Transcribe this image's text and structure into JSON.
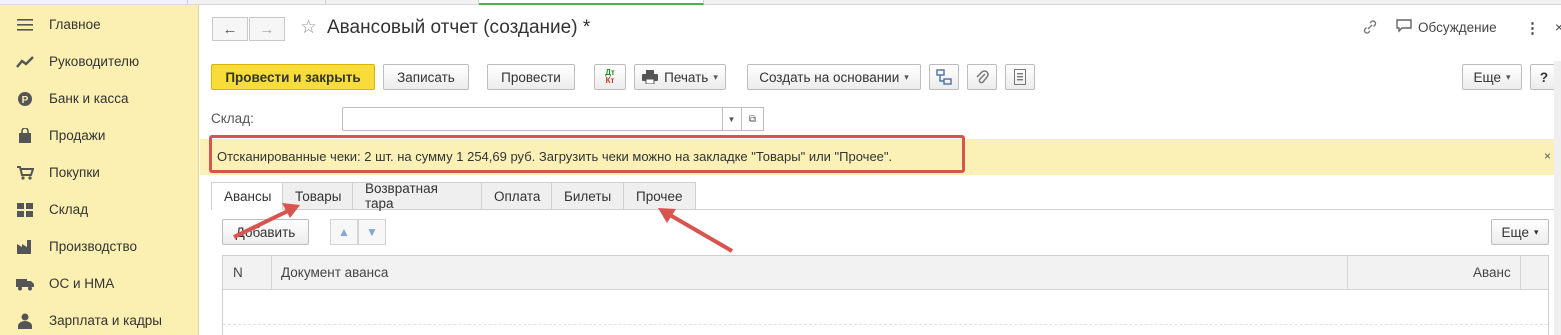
{
  "sidebar": {
    "items": [
      {
        "label": "Главное",
        "icon": "menu-lines-icon"
      },
      {
        "label": "Руководителю",
        "icon": "trend-chart-icon"
      },
      {
        "label": "Банк и касса",
        "icon": "coin-icon"
      },
      {
        "label": "Продажи",
        "icon": "shopping-bag-icon"
      },
      {
        "label": "Покупки",
        "icon": "cart-icon"
      },
      {
        "label": "Склад",
        "icon": "warehouse-grid-icon"
      },
      {
        "label": "Производство",
        "icon": "factory-icon"
      },
      {
        "label": "ОС и НМА",
        "icon": "truck-icon"
      },
      {
        "label": "Зарплата и кадры",
        "icon": "person-icon"
      }
    ]
  },
  "header": {
    "title": "Авансовый отчет (создание) *",
    "discussion": "Обсуждение"
  },
  "toolbar": {
    "post_close": "Провести и закрыть",
    "save": "Записать",
    "post": "Провести",
    "dt_kt_top": "Дт",
    "dt_kt_bottom": "Кт",
    "print": "Печать",
    "create_based": "Создать на основании",
    "more": "Еще",
    "help": "?"
  },
  "form": {
    "warehouse_label": "Склад:",
    "warehouse_value": ""
  },
  "banner": {
    "text": "Отсканированные чеки: 2 шт. на сумму 1 254,69 руб. Загрузить чеки можно на закладке \"Товары\" или \"Прочее\".",
    "close": "×"
  },
  "tabs": [
    "Авансы",
    "Товары",
    "Возвратная тара",
    "Оплата",
    "Билеты",
    "Прочее"
  ],
  "table_toolbar": {
    "add": "Добавить",
    "more": "Еще"
  },
  "table": {
    "columns": [
      "N",
      "Документ аванса",
      "Аванс"
    ],
    "rows": []
  },
  "colors": {
    "sidebar_bg": "#fbf0b2",
    "primary_button": "#f8dc3a",
    "banner_bg": "#fbf1b6",
    "highlight_red": "#d9534f"
  }
}
